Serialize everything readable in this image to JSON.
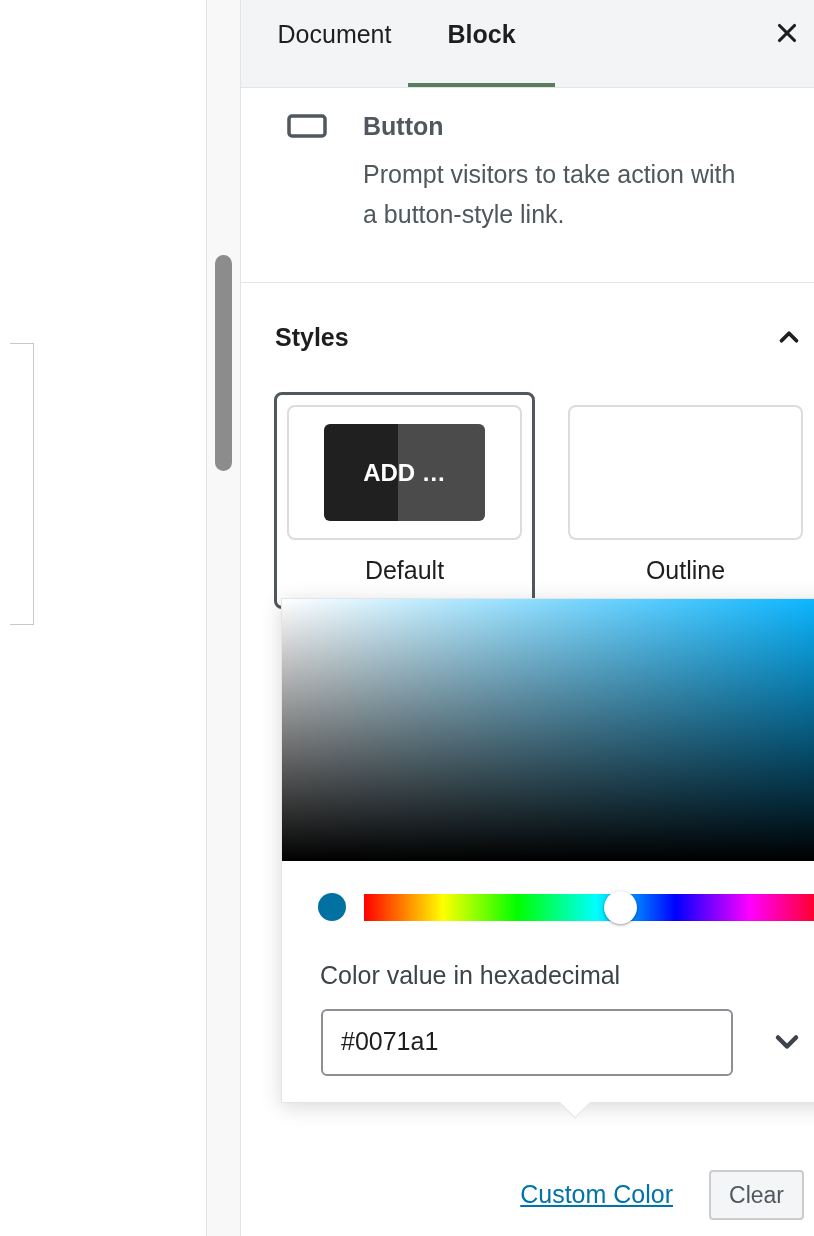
{
  "tabs": [
    {
      "label": "Document",
      "selected": false
    },
    {
      "label": "Block",
      "selected": true
    }
  ],
  "block_card": {
    "title": "Button",
    "description": "Prompt visitors to take action with a button-style link."
  },
  "styles_panel": {
    "title": "Styles",
    "expanded": true,
    "options": [
      {
        "label": "Default",
        "preview": "ADD …",
        "selected": true
      },
      {
        "label": "Outline",
        "selected": false
      }
    ]
  },
  "color_picker": {
    "hue": {
      "level": 0.55
    },
    "field_label": "Color value in hexadecimal",
    "value": "#0071a1"
  },
  "footer": {
    "link": "Custom Color",
    "button": "Clear"
  }
}
